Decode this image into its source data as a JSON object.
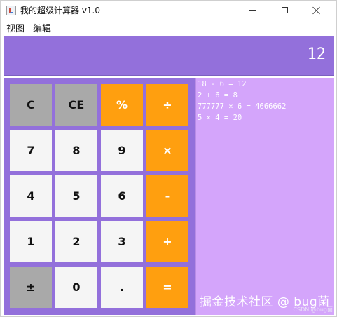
{
  "window": {
    "title": "我的超级计算器 v1.0"
  },
  "menu": {
    "items": [
      "视图",
      "编辑"
    ]
  },
  "display": {
    "value": "12"
  },
  "keypad": {
    "keys": [
      {
        "label": "C",
        "style": "gray"
      },
      {
        "label": "CE",
        "style": "gray"
      },
      {
        "label": "%",
        "style": "orange"
      },
      {
        "label": "÷",
        "style": "orange"
      },
      {
        "label": "7",
        "style": "white"
      },
      {
        "label": "8",
        "style": "white"
      },
      {
        "label": "9",
        "style": "white"
      },
      {
        "label": "×",
        "style": "orange"
      },
      {
        "label": "4",
        "style": "white"
      },
      {
        "label": "5",
        "style": "white"
      },
      {
        "label": "6",
        "style": "white"
      },
      {
        "label": "-",
        "style": "orange"
      },
      {
        "label": "1",
        "style": "white"
      },
      {
        "label": "2",
        "style": "white"
      },
      {
        "label": "3",
        "style": "white"
      },
      {
        "label": "+",
        "style": "orange"
      },
      {
        "label": "±",
        "style": "gray"
      },
      {
        "label": "0",
        "style": "white"
      },
      {
        "label": ".",
        "style": "white"
      },
      {
        "label": "=",
        "style": "orange"
      }
    ]
  },
  "history": {
    "lines": [
      "18 - 6 = 12",
      "2 + 6 = 8",
      "777777 × 6 = 4666662",
      "5 × 4 = 20"
    ]
  },
  "watermark": {
    "main": "掘金技术社区 @ bug菌",
    "sub": "CSDN @bug菌"
  },
  "colors": {
    "display_bg": "#9370db",
    "keypad_bg": "#9370db",
    "history_bg": "#d4a5fb",
    "key_gray": "#a9a9a9",
    "key_white": "#f5f5f5",
    "key_orange": "#ff9f0f"
  }
}
